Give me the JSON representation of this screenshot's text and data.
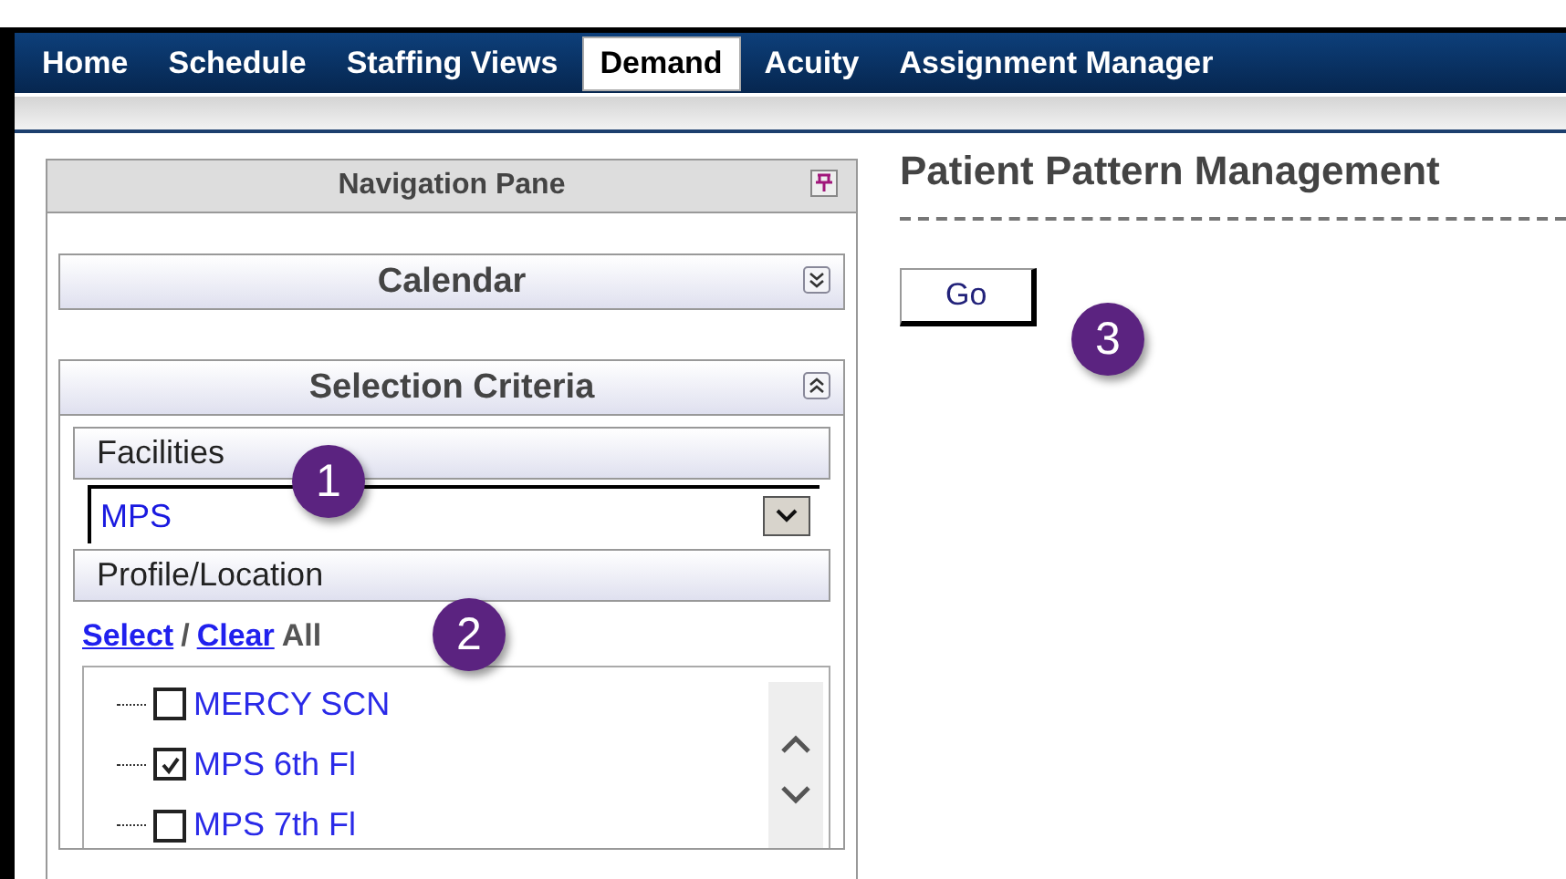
{
  "nav_tabs": [
    {
      "label": "Home",
      "selected": false
    },
    {
      "label": "Schedule",
      "selected": false
    },
    {
      "label": "Staffing Views",
      "selected": false
    },
    {
      "label": "Demand",
      "selected": true
    },
    {
      "label": "Acuity",
      "selected": false
    },
    {
      "label": "Assignment Manager",
      "selected": false
    }
  ],
  "navigation_pane": {
    "title": "Navigation Pane",
    "sections": [
      {
        "title": "Calendar",
        "expanded": false
      },
      {
        "title": "Selection Criteria",
        "expanded": true
      }
    ],
    "facilities": {
      "label": "Facilities",
      "value": "MPS"
    },
    "profile_location": {
      "label": "Profile/Location",
      "select_link": "Select",
      "separator": "/",
      "clear_link": "Clear",
      "all_text": "All",
      "items": [
        {
          "label": "MERCY SCN",
          "checked": false
        },
        {
          "label": "MPS 6th Fl",
          "checked": true
        },
        {
          "label": "MPS 7th Fl",
          "checked": false
        }
      ]
    }
  },
  "page_title": "Patient Pattern Management",
  "go_button": "Go",
  "callouts": [
    "1",
    "2",
    "3"
  ]
}
